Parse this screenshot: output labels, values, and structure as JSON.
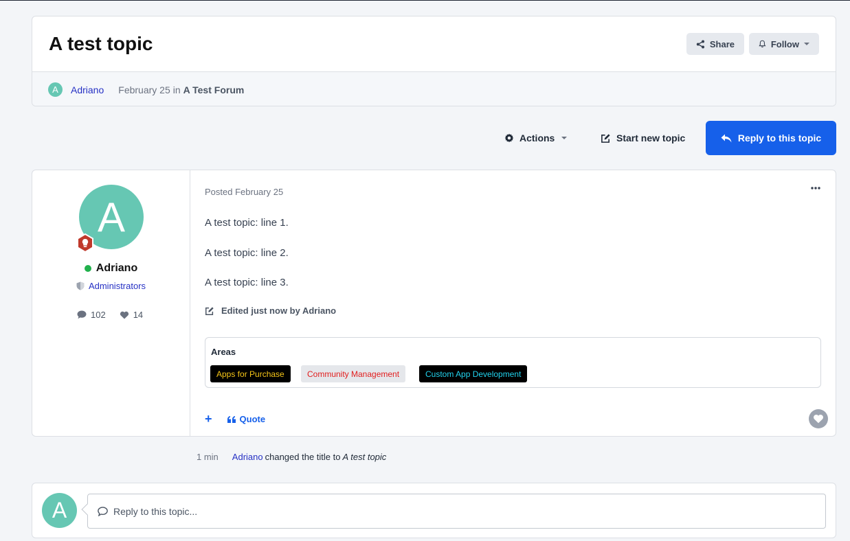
{
  "topic": {
    "title": "A test topic",
    "share_label": "Share",
    "follow_label": "Follow",
    "author": "Adriano",
    "author_initial": "A",
    "date": "February 25",
    "in_label": "in",
    "forum": "A Test Forum"
  },
  "toolbar": {
    "actions_label": "Actions",
    "start_topic_label": "Start new topic",
    "reply_label": "Reply to this topic"
  },
  "post": {
    "author": {
      "name": "Adriano",
      "initial": "A",
      "group": "Administrators",
      "posts_count": "102",
      "reputation": "14",
      "online": true
    },
    "posted_label": "Posted February 25",
    "lines": [
      "A test topic: line 1.",
      "A test topic: line 2.",
      "A test topic: line 3."
    ],
    "edited_label": "Edited just now by Adriano",
    "areas": {
      "title": "Areas",
      "tags": [
        {
          "label": "Apps for Purchase",
          "bg": "#000000",
          "fg": "#f5c518"
        },
        {
          "label": "Community Management",
          "bg": "#e5e7eb",
          "fg": "#e11d1d"
        },
        {
          "label": "Custom App Development",
          "bg": "#000000",
          "fg": "#22d3ee"
        }
      ]
    },
    "quote_label": "Quote"
  },
  "event": {
    "time": "1 min",
    "user": "Adriano",
    "text": "changed the title to",
    "new_title": "A test topic"
  },
  "reply_box": {
    "initial": "A",
    "placeholder": "Reply to this topic..."
  },
  "colors": {
    "accent": "#1660ea",
    "avatar": "#66c7b3",
    "link": "#2530c4",
    "online": "#21b14c"
  }
}
